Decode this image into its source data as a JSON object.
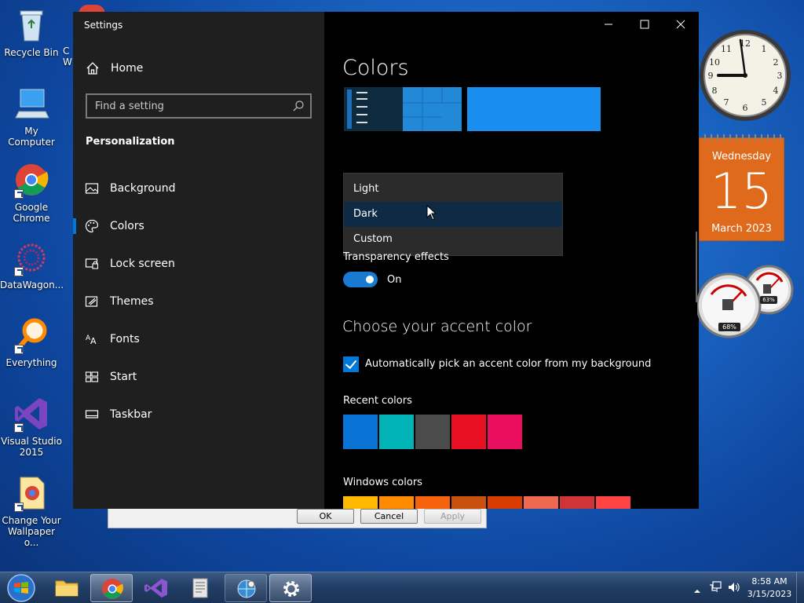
{
  "desktop": {
    "icons": [
      {
        "label": "Recycle Bin"
      },
      {
        "label": "My Computer"
      },
      {
        "label": "Google Chrome"
      },
      {
        "label": "DataWagon..."
      },
      {
        "label": "Everything"
      },
      {
        "label": "Visual Studio 2015"
      },
      {
        "label": "Change Your Wallpaper o..."
      }
    ],
    "partial_icon_label": "C\nW"
  },
  "old_dialog": {
    "ok_label": "OK",
    "cancel_label": "Cancel",
    "apply_label": "Apply"
  },
  "settings": {
    "window_title": "Settings",
    "home_label": "Home",
    "search_placeholder": "Find a setting",
    "section_title": "Personalization",
    "nav_items": [
      {
        "label": "Background",
        "icon": "picture-icon"
      },
      {
        "label": "Colors",
        "icon": "palette-icon",
        "active": true
      },
      {
        "label": "Lock screen",
        "icon": "lock-screen-icon"
      },
      {
        "label": "Themes",
        "icon": "themes-icon"
      },
      {
        "label": "Fonts",
        "icon": "fonts-icon"
      },
      {
        "label": "Start",
        "icon": "start-icon"
      },
      {
        "label": "Taskbar",
        "icon": "taskbar-icon"
      }
    ],
    "page_title": "Colors",
    "mode_dropdown": {
      "options": [
        "Light",
        "Dark",
        "Custom"
      ],
      "selected": "Dark"
    },
    "transparency_label": "Transparency effects",
    "transparency_state": "On",
    "accent_heading": "Choose your accent color",
    "auto_accent_label": "Automatically pick an accent color from my background",
    "recent_colors_label": "Recent colors",
    "recent_colors": [
      "#0a74d6",
      "#00b3b7",
      "#4b4b4b",
      "#e81123",
      "#ea0e5f"
    ],
    "windows_colors_label": "Windows colors",
    "windows_colors": [
      "#ffb900",
      "#ff8c00",
      "#f7630c",
      "#ca5010",
      "#da3b01",
      "#ef6950",
      "#d13438",
      "#ff4343"
    ]
  },
  "gadgets": {
    "calendar": {
      "weekday": "Wednesday",
      "day": "15",
      "month_year": "March 2023"
    },
    "meter": {
      "cpu": "68%",
      "ram": "63%"
    }
  },
  "taskbar": {
    "time": "8:58 AM",
    "date": "3/15/2023"
  },
  "colors": {
    "accent": "#0078d7",
    "sidebar_bg": "#1f1f1f",
    "content_bg": "#000000",
    "calendar": "#e06a1b"
  }
}
